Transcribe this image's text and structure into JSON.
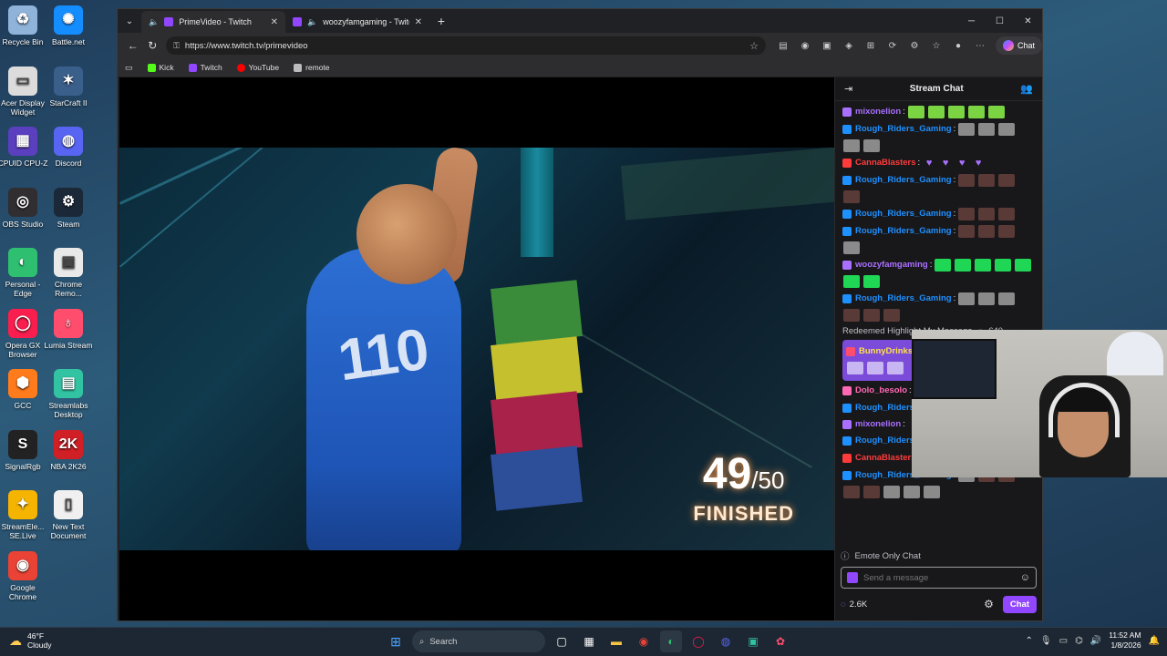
{
  "desktop": {
    "icons": [
      {
        "label": "Recycle Bin",
        "icon": "recycle-bin-icon",
        "color": "#8fb3d9"
      },
      {
        "label": "Battle.net",
        "icon": "battlenet-icon",
        "color": "#148eff"
      },
      {
        "label": "Acer Display Widget",
        "icon": "acer-widget-icon",
        "color": "#dcdcdc"
      },
      {
        "label": "StarCraft II",
        "icon": "starcraft-icon",
        "color": "#3a5f8a"
      },
      {
        "label": "CPUID CPU-Z",
        "icon": "cpuz-icon",
        "color": "#5a3fbf"
      },
      {
        "label": "Discord",
        "icon": "discord-icon",
        "color": "#5865f2"
      },
      {
        "label": "OBS Studio",
        "icon": "obs-icon",
        "color": "#302e31"
      },
      {
        "label": "Steam",
        "icon": "steam-icon",
        "color": "#1b2838"
      },
      {
        "label": "Personal - Edge",
        "icon": "edge-icon",
        "color": "#2fbf71"
      },
      {
        "label": "Chrome Remo...",
        "icon": "chrome-remote-icon",
        "color": "#e9e9e9"
      },
      {
        "label": "Opera GX Browser",
        "icon": "opera-gx-icon",
        "color": "#fa1e4e"
      },
      {
        "label": "Lumia Stream",
        "icon": "lumia-icon",
        "color": "#ff4d6d"
      },
      {
        "label": "GCC",
        "icon": "gcc-icon",
        "color": "#ff7b1c"
      },
      {
        "label": "Streamlabs Desktop",
        "icon": "streamlabs-icon",
        "color": "#31c3a2"
      },
      {
        "label": "SignalRgb",
        "icon": "signalrgb-icon",
        "color": "#222222"
      },
      {
        "label": "NBA 2K26",
        "icon": "nba2k-icon",
        "color": "#d11f26"
      },
      {
        "label": "StreamEle... SE.Live",
        "icon": "streamelements-icon",
        "color": "#f5b400"
      },
      {
        "label": "New Text Document",
        "icon": "text-document-icon",
        "color": "#f0f0f0"
      },
      {
        "label": "Google Chrome",
        "icon": "chrome-icon",
        "color": "#ea4335"
      }
    ]
  },
  "browser": {
    "tabs": [
      {
        "title": "PrimeVideo - Twitch",
        "active": true
      },
      {
        "title": "woozyfamgaming - Twitch",
        "active": false
      }
    ],
    "url": "https://www.twitch.tv/primevideo",
    "copilot_label": "Chat",
    "bookmarks": [
      {
        "label": "Kick",
        "color": "#53fc18"
      },
      {
        "label": "Twitch",
        "color": "#9146ff"
      },
      {
        "label": "YouTube",
        "color": "#ff0000"
      },
      {
        "label": "remote",
        "color": "#bbbbbb"
      }
    ]
  },
  "video": {
    "jersey_number": "110",
    "counter_main": "49",
    "counter_total": "/50",
    "counter_label": "FINISHED"
  },
  "chat": {
    "title": "Stream Chat",
    "messages": [
      {
        "user": "mixonelion",
        "color": "#a970ff",
        "emotes": [
          "green",
          "green",
          "green",
          "green",
          "green"
        ]
      },
      {
        "user": "Rough_Riders_Gaming",
        "color": "#1e90ff",
        "emotes": [
          "gray",
          "gray",
          "gray",
          "gray",
          "gray"
        ]
      },
      {
        "user": "CannaBlasters",
        "color": "#ff3b3b",
        "emotes": [
          "heart",
          "heart",
          "heart",
          "heart"
        ]
      },
      {
        "user": "Rough_Riders_Gaming",
        "color": "#1e90ff",
        "emotes": [
          "dark",
          "dark",
          "dark",
          "dark"
        ]
      },
      {
        "user": "Rough_Riders_Gaming",
        "color": "#1e90ff",
        "emotes": [
          "dark",
          "dark",
          "dark"
        ]
      },
      {
        "user": "Rough_Riders_Gaming",
        "color": "#1e90ff",
        "emotes": [
          "dark",
          "dark",
          "dark",
          "gray"
        ]
      },
      {
        "user": "woozyfamgaming",
        "color": "#a970ff",
        "emotes": [
          "neon",
          "neon",
          "neon",
          "neon",
          "neon",
          "neon",
          "neon"
        ]
      },
      {
        "user": "Rough_Riders_Gaming",
        "color": "#1e90ff",
        "emotes": [
          "gray",
          "gray",
          "gray",
          "dark",
          "dark",
          "dark"
        ]
      }
    ],
    "highlight_note": "Redeemed Highlight My Message",
    "highlight_cost": "640",
    "highlight": {
      "user": "BunnyDrinks"
    },
    "messages_after": [
      {
        "user": "Dolo_besolo",
        "color": "#ff69b4",
        "emotes": [
          "hand",
          "hand",
          "hand"
        ]
      },
      {
        "user": "Rough_Riders",
        "color": "#1e90ff",
        "emotes": [
          "dark",
          "dark"
        ]
      },
      {
        "user": "mixonelion",
        "color": "#a970ff",
        "emotes": []
      },
      {
        "user": "Rough_Riders",
        "color": "#1e90ff",
        "emotes": [
          "dark"
        ]
      },
      {
        "user": "CannaBlasters",
        "color": "#ff3b3b",
        "emotes": [
          "white",
          "white",
          "white",
          "white",
          "white"
        ]
      },
      {
        "user": "Rough_Riders_Gaming",
        "color": "#1e90ff",
        "emotes": [
          "gray",
          "dark",
          "dark",
          "dark",
          "dark",
          "gray",
          "gray",
          "gray"
        ]
      }
    ],
    "emote_only": "Emote Only Chat",
    "input_placeholder": "Send a message",
    "points": "2.6K",
    "send_label": "Chat"
  },
  "taskbar": {
    "temperature": "46°F",
    "weather": "Cloudy",
    "search_label": "Search",
    "time": "11:52 AM",
    "date": "1/8/2026"
  }
}
